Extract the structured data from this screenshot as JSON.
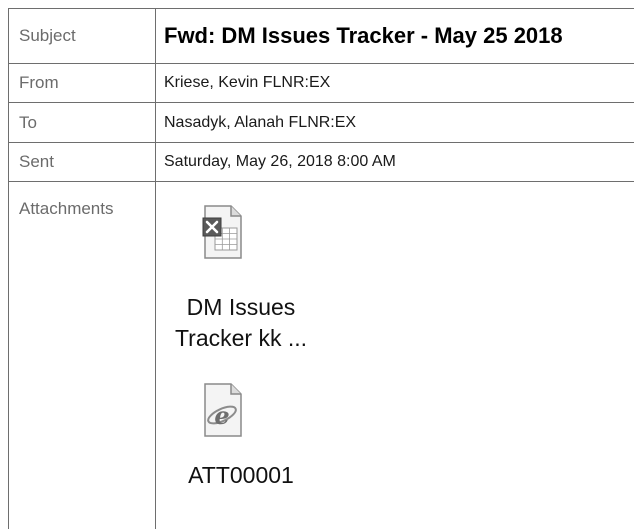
{
  "email": {
    "subject_label": "Subject",
    "subject": "Fwd: DM Issues Tracker - May 25 2018",
    "from_label": "From",
    "from": "Kriese, Kevin FLNR:EX",
    "to_label": "To",
    "to": "Nasadyk, Alanah FLNR:EX",
    "sent_label": "Sent",
    "sent": "Saturday, May 26, 2018 8:00 AM",
    "attachments_label": "Attachments",
    "attachments": [
      {
        "name_line1": "DM Issues",
        "name_line2": "Tracker kk ...",
        "icon": "excel-file-icon"
      },
      {
        "name_line1": "ATT00001",
        "icon": "html-file-icon"
      }
    ]
  }
}
